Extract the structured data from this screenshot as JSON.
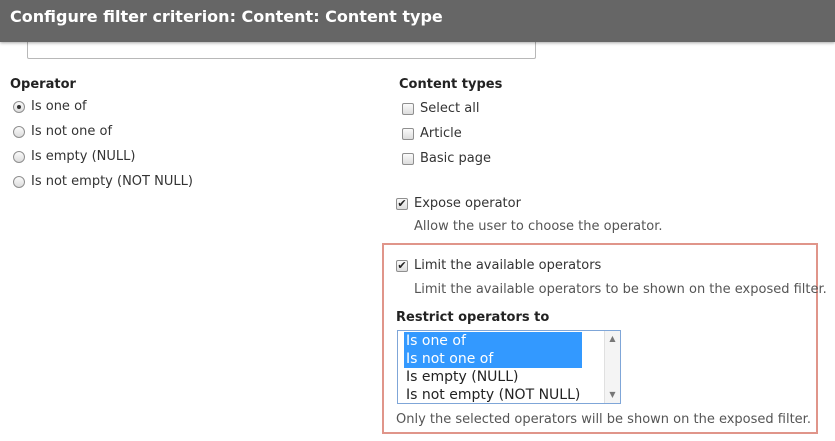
{
  "dialog": {
    "title": "Configure filter criterion: Content: Content type"
  },
  "operator": {
    "heading": "Operator",
    "options": [
      {
        "label": "Is one of",
        "checked": true
      },
      {
        "label": "Is not one of",
        "checked": false
      },
      {
        "label": "Is empty (NULL)",
        "checked": false
      },
      {
        "label": "Is not empty (NOT NULL)",
        "checked": false
      }
    ]
  },
  "content_types": {
    "heading": "Content types",
    "options": [
      {
        "label": "Select all",
        "checked": false
      },
      {
        "label": "Article",
        "checked": false
      },
      {
        "label": "Basic page",
        "checked": false
      }
    ]
  },
  "expose_operator": {
    "label": "Expose operator",
    "checked": true,
    "description": "Allow the user to choose the operator."
  },
  "limit_operators": {
    "label": "Limit the available operators",
    "checked": true,
    "description": "Limit the available operators to be shown on the exposed filter."
  },
  "restrict": {
    "heading": "Restrict operators to",
    "options": [
      {
        "label": "Is one of",
        "selected": true
      },
      {
        "label": "Is not one of",
        "selected": true
      },
      {
        "label": "Is empty (NULL)",
        "selected": false
      },
      {
        "label": "Is not empty (NOT NULL)",
        "selected": false
      }
    ],
    "description": "Only the selected operators will be shown on the exposed filter."
  },
  "colors": {
    "titlebar": "#666666",
    "highlight_border": "#e0958a",
    "selection": "#3399ff"
  }
}
